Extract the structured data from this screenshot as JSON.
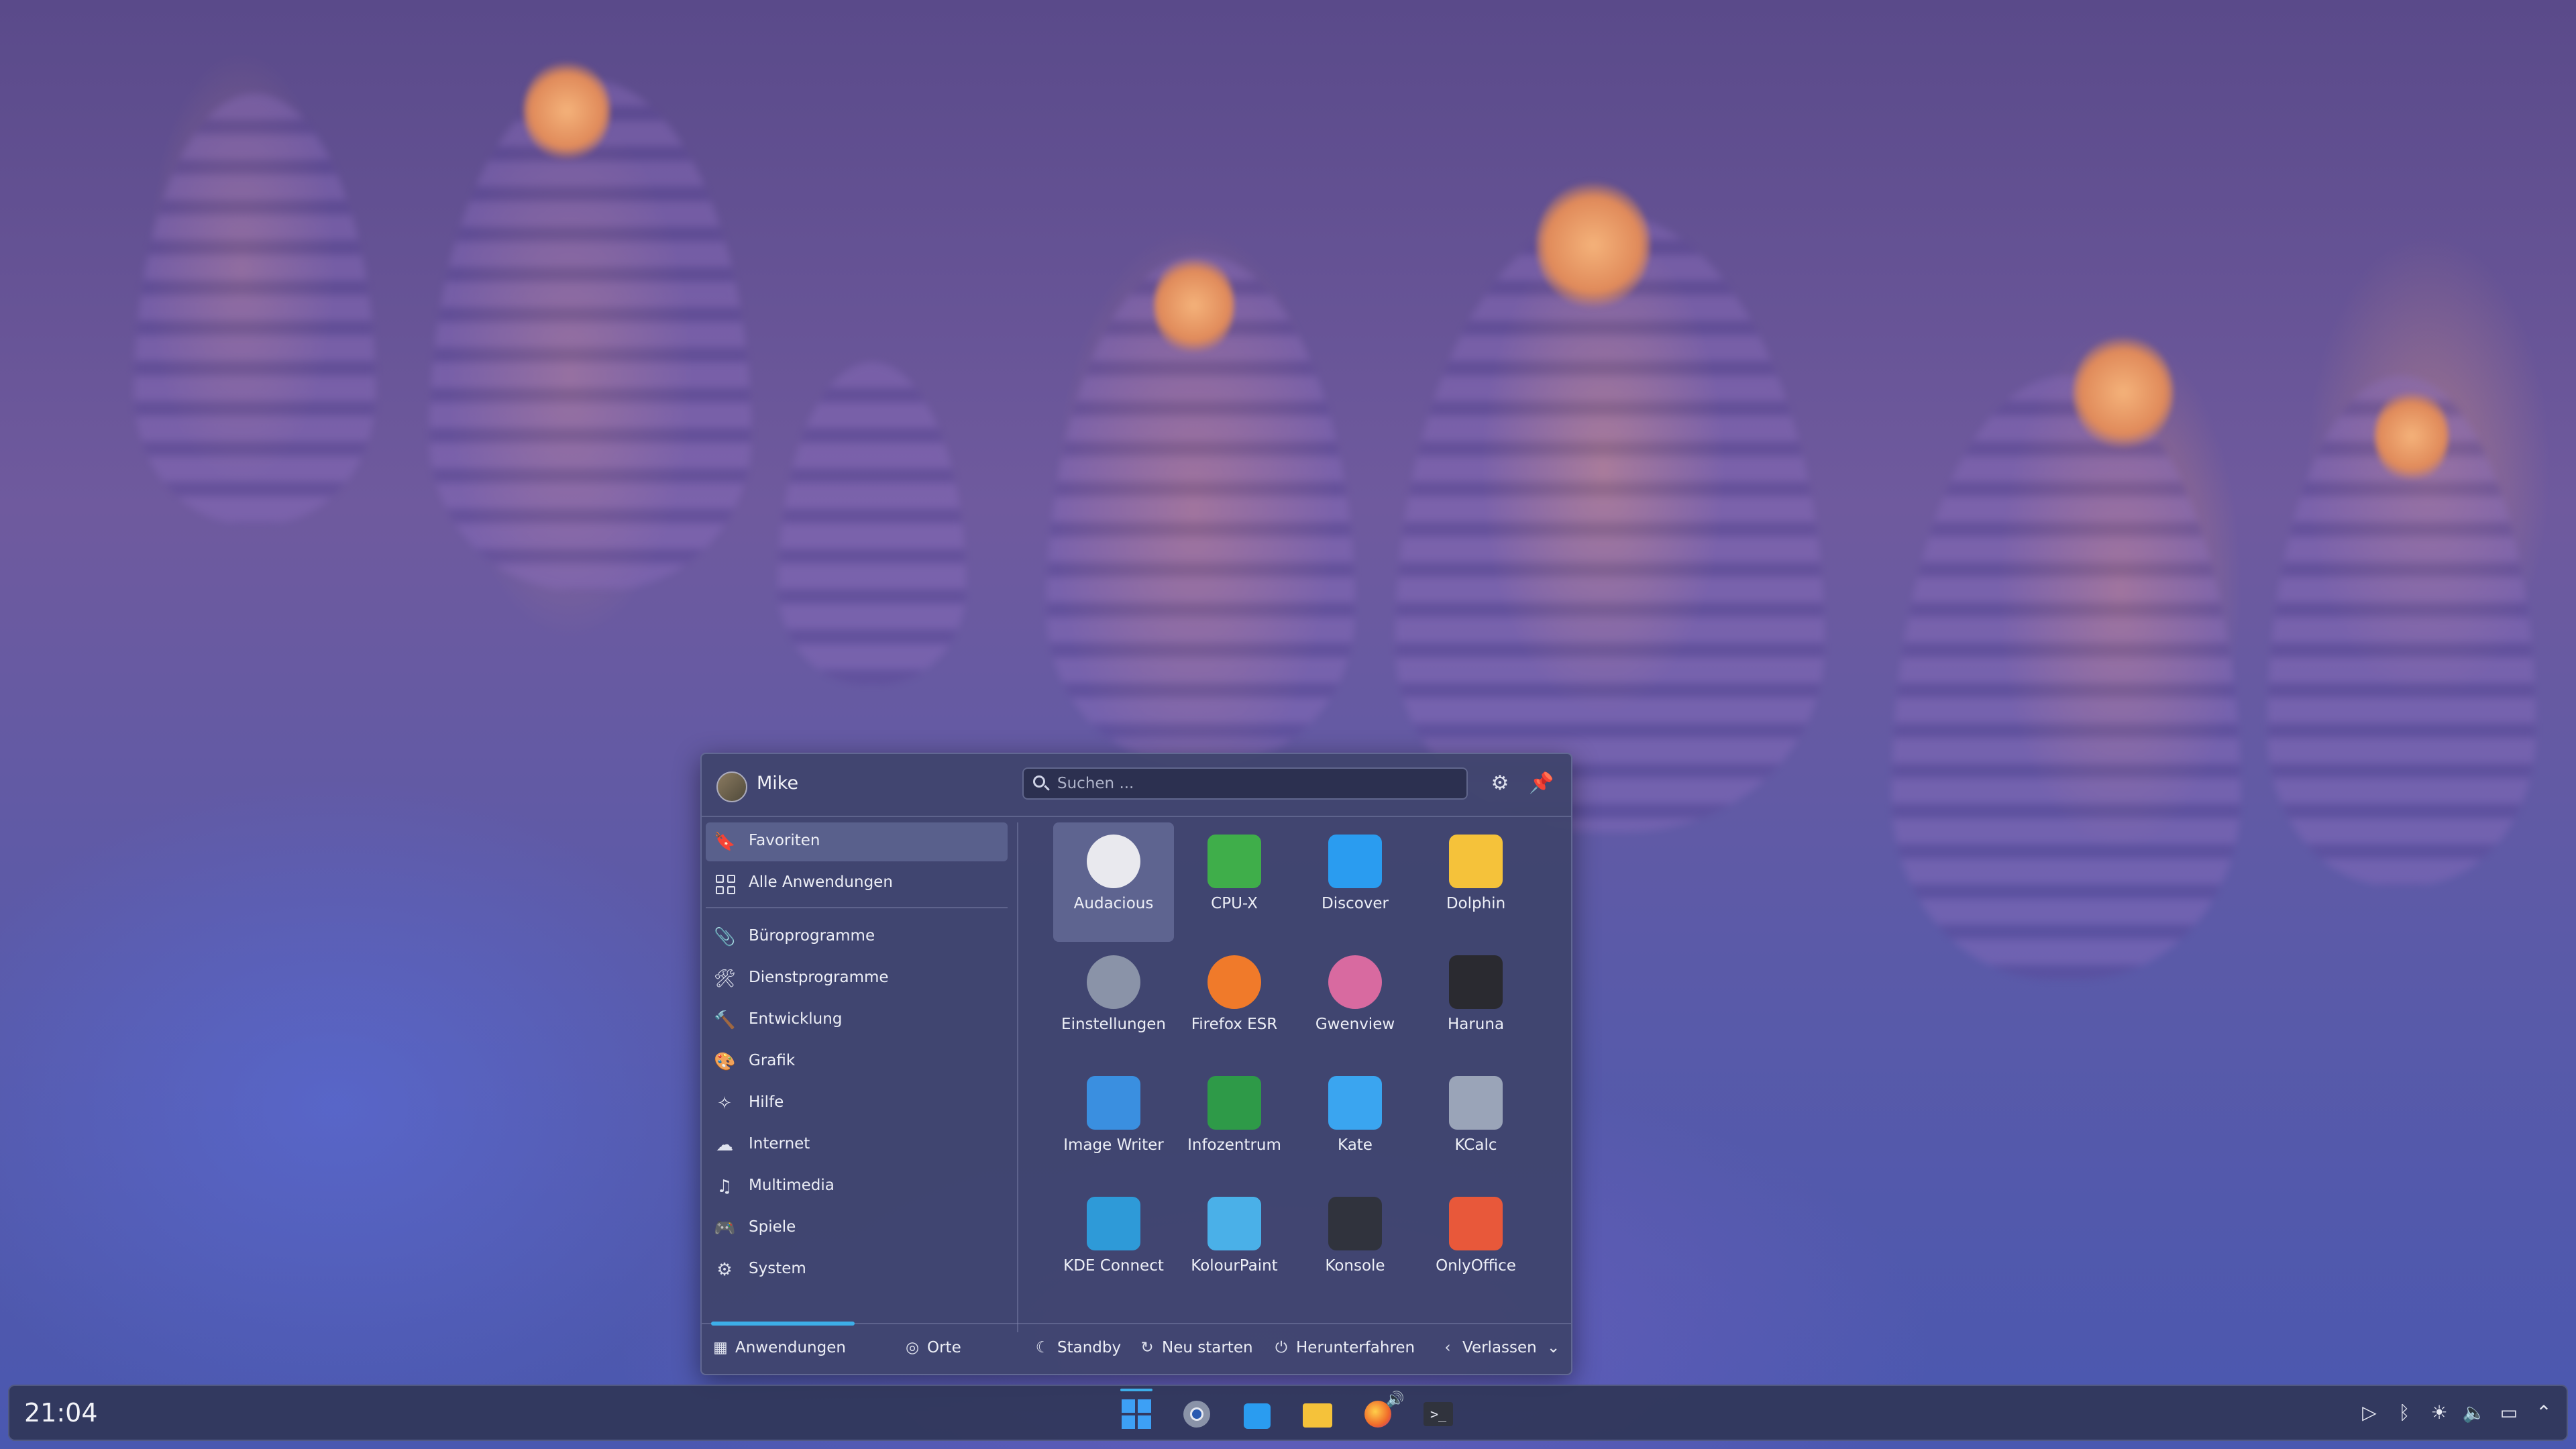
{
  "launcher": {
    "user": "Mike",
    "search_placeholder": "Suchen ...",
    "sidebar": {
      "favorites": "Favoriten",
      "all_apps": "Alle Anwendungen",
      "categories": [
        "Büroprogramme",
        "Dienstprogramme",
        "Entwicklung",
        "Grafik",
        "Hilfe",
        "Internet",
        "Multimedia",
        "Spiele",
        "System"
      ]
    },
    "apps": [
      {
        "name": "Audacious",
        "icon": "audacious-icon",
        "color": "#e9e9ee"
      },
      {
        "name": "CPU-X",
        "icon": "cpu-x-icon",
        "color": "#3fae4a"
      },
      {
        "name": "Discover",
        "icon": "discover-icon",
        "color": "#2a9cf0"
      },
      {
        "name": "Dolphin",
        "icon": "dolphin-folder-icon",
        "color": "#f5c23a"
      },
      {
        "name": "Einstellungen",
        "icon": "settings-gear-icon",
        "color": "#8a93a8"
      },
      {
        "name": "Firefox ESR",
        "icon": "firefox-icon",
        "color": "#f07a2a"
      },
      {
        "name": "Gwenview",
        "icon": "gwenview-icon",
        "color": "#d86aa0"
      },
      {
        "name": "Haruna",
        "icon": "haruna-icon",
        "color": "#2a2a30"
      },
      {
        "name": "Image Writer",
        "icon": "usb-stick-icon",
        "color": "#3a8fe0"
      },
      {
        "name": "Infozentrum",
        "icon": "info-icon",
        "color": "#2e9a48"
      },
      {
        "name": "Kate",
        "icon": "kate-icon",
        "color": "#3aa5f0"
      },
      {
        "name": "KCalc",
        "icon": "calculator-icon",
        "color": "#9aa4b8"
      },
      {
        "name": "KDE Connect",
        "icon": "kde-connect-icon",
        "color": "#2e9ad8"
      },
      {
        "name": "KolourPaint",
        "icon": "palette-icon",
        "color": "#4ab0e8"
      },
      {
        "name": "Konsole",
        "icon": "terminal-icon",
        "color": "#30333d"
      },
      {
        "name": "OnlyOffice",
        "icon": "onlyoffice-icon",
        "color": "#e8583a"
      }
    ],
    "footer": {
      "applications": "Anwendungen",
      "places": "Orte",
      "standby": "Standby",
      "restart": "Neu starten",
      "shutdown": "Herunterfahren",
      "leave": "Verlassen"
    }
  },
  "taskbar": {
    "clock": "21:04",
    "pinned": [
      "launcher-icon",
      "settings-icon",
      "discover-icon",
      "dolphin-icon",
      "firefox-icon",
      "konsole-icon"
    ]
  },
  "colors": {
    "accent": "#3daee9"
  }
}
